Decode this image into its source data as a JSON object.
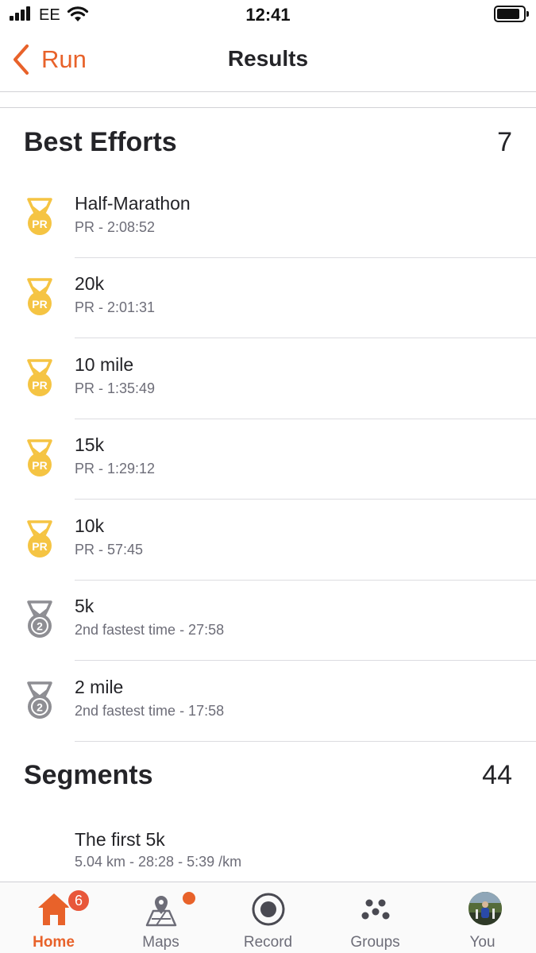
{
  "status_bar": {
    "carrier": "EE",
    "time": "12:41"
  },
  "nav": {
    "back_label": "Run",
    "title": "Results"
  },
  "best_efforts": {
    "title": "Best Efforts",
    "count": "7",
    "items": [
      {
        "title": "Half-Marathon",
        "subtitle": "PR - 2:08:52",
        "medal": "pr-medal-icon"
      },
      {
        "title": "20k",
        "subtitle": "PR - 2:01:31",
        "medal": "pr-medal-icon"
      },
      {
        "title": "10 mile",
        "subtitle": "PR - 1:35:49",
        "medal": "pr-medal-icon"
      },
      {
        "title": "15k",
        "subtitle": "PR - 1:29:12",
        "medal": "pr-medal-icon"
      },
      {
        "title": "10k",
        "subtitle": "PR - 57:45",
        "medal": "pr-medal-icon"
      },
      {
        "title": "5k",
        "subtitle": "2nd fastest time - 27:58",
        "medal": "second-place-medal-icon"
      },
      {
        "title": "2 mile",
        "subtitle": "2nd fastest time - 17:58",
        "medal": "second-place-medal-icon"
      }
    ]
  },
  "segments": {
    "title": "Segments",
    "count": "44",
    "items": [
      {
        "title": "The first 5k",
        "subtitle": "5.04 km - 28:28 - 5:39 /km"
      }
    ]
  },
  "tab_bar": {
    "tabs": [
      {
        "label": "Home",
        "icon": "home-icon",
        "active": true,
        "badge": "6"
      },
      {
        "label": "Maps",
        "icon": "maps-icon"
      },
      {
        "label": "Record",
        "icon": "record-icon"
      },
      {
        "label": "Groups",
        "icon": "groups-icon"
      },
      {
        "label": "You",
        "icon": "avatar"
      }
    ]
  },
  "colors": {
    "accent": "#e8622a",
    "pr_gold": "#f5c443",
    "second_silver": "#8e8e93",
    "badge": "#e8573a"
  }
}
